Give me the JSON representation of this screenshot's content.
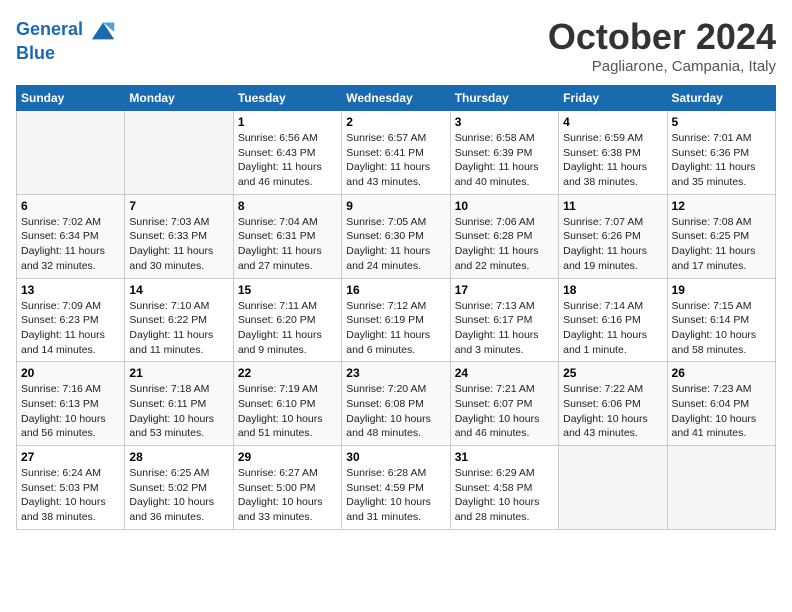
{
  "header": {
    "logo_line1": "General",
    "logo_line2": "Blue",
    "month": "October 2024",
    "location": "Pagliarone, Campania, Italy"
  },
  "weekdays": [
    "Sunday",
    "Monday",
    "Tuesday",
    "Wednesday",
    "Thursday",
    "Friday",
    "Saturday"
  ],
  "weeks": [
    [
      {
        "day": "",
        "empty": true
      },
      {
        "day": "",
        "empty": true
      },
      {
        "day": "1",
        "sunrise": "Sunrise: 6:56 AM",
        "sunset": "Sunset: 6:43 PM",
        "daylight": "Daylight: 11 hours and 46 minutes."
      },
      {
        "day": "2",
        "sunrise": "Sunrise: 6:57 AM",
        "sunset": "Sunset: 6:41 PM",
        "daylight": "Daylight: 11 hours and 43 minutes."
      },
      {
        "day": "3",
        "sunrise": "Sunrise: 6:58 AM",
        "sunset": "Sunset: 6:39 PM",
        "daylight": "Daylight: 11 hours and 40 minutes."
      },
      {
        "day": "4",
        "sunrise": "Sunrise: 6:59 AM",
        "sunset": "Sunset: 6:38 PM",
        "daylight": "Daylight: 11 hours and 38 minutes."
      },
      {
        "day": "5",
        "sunrise": "Sunrise: 7:01 AM",
        "sunset": "Sunset: 6:36 PM",
        "daylight": "Daylight: 11 hours and 35 minutes."
      }
    ],
    [
      {
        "day": "6",
        "sunrise": "Sunrise: 7:02 AM",
        "sunset": "Sunset: 6:34 PM",
        "daylight": "Daylight: 11 hours and 32 minutes."
      },
      {
        "day": "7",
        "sunrise": "Sunrise: 7:03 AM",
        "sunset": "Sunset: 6:33 PM",
        "daylight": "Daylight: 11 hours and 30 minutes."
      },
      {
        "day": "8",
        "sunrise": "Sunrise: 7:04 AM",
        "sunset": "Sunset: 6:31 PM",
        "daylight": "Daylight: 11 hours and 27 minutes."
      },
      {
        "day": "9",
        "sunrise": "Sunrise: 7:05 AM",
        "sunset": "Sunset: 6:30 PM",
        "daylight": "Daylight: 11 hours and 24 minutes."
      },
      {
        "day": "10",
        "sunrise": "Sunrise: 7:06 AM",
        "sunset": "Sunset: 6:28 PM",
        "daylight": "Daylight: 11 hours and 22 minutes."
      },
      {
        "day": "11",
        "sunrise": "Sunrise: 7:07 AM",
        "sunset": "Sunset: 6:26 PM",
        "daylight": "Daylight: 11 hours and 19 minutes."
      },
      {
        "day": "12",
        "sunrise": "Sunrise: 7:08 AM",
        "sunset": "Sunset: 6:25 PM",
        "daylight": "Daylight: 11 hours and 17 minutes."
      }
    ],
    [
      {
        "day": "13",
        "sunrise": "Sunrise: 7:09 AM",
        "sunset": "Sunset: 6:23 PM",
        "daylight": "Daylight: 11 hours and 14 minutes."
      },
      {
        "day": "14",
        "sunrise": "Sunrise: 7:10 AM",
        "sunset": "Sunset: 6:22 PM",
        "daylight": "Daylight: 11 hours and 11 minutes."
      },
      {
        "day": "15",
        "sunrise": "Sunrise: 7:11 AM",
        "sunset": "Sunset: 6:20 PM",
        "daylight": "Daylight: 11 hours and 9 minutes."
      },
      {
        "day": "16",
        "sunrise": "Sunrise: 7:12 AM",
        "sunset": "Sunset: 6:19 PM",
        "daylight": "Daylight: 11 hours and 6 minutes."
      },
      {
        "day": "17",
        "sunrise": "Sunrise: 7:13 AM",
        "sunset": "Sunset: 6:17 PM",
        "daylight": "Daylight: 11 hours and 3 minutes."
      },
      {
        "day": "18",
        "sunrise": "Sunrise: 7:14 AM",
        "sunset": "Sunset: 6:16 PM",
        "daylight": "Daylight: 11 hours and 1 minute."
      },
      {
        "day": "19",
        "sunrise": "Sunrise: 7:15 AM",
        "sunset": "Sunset: 6:14 PM",
        "daylight": "Daylight: 10 hours and 58 minutes."
      }
    ],
    [
      {
        "day": "20",
        "sunrise": "Sunrise: 7:16 AM",
        "sunset": "Sunset: 6:13 PM",
        "daylight": "Daylight: 10 hours and 56 minutes."
      },
      {
        "day": "21",
        "sunrise": "Sunrise: 7:18 AM",
        "sunset": "Sunset: 6:11 PM",
        "daylight": "Daylight: 10 hours and 53 minutes."
      },
      {
        "day": "22",
        "sunrise": "Sunrise: 7:19 AM",
        "sunset": "Sunset: 6:10 PM",
        "daylight": "Daylight: 10 hours and 51 minutes."
      },
      {
        "day": "23",
        "sunrise": "Sunrise: 7:20 AM",
        "sunset": "Sunset: 6:08 PM",
        "daylight": "Daylight: 10 hours and 48 minutes."
      },
      {
        "day": "24",
        "sunrise": "Sunrise: 7:21 AM",
        "sunset": "Sunset: 6:07 PM",
        "daylight": "Daylight: 10 hours and 46 minutes."
      },
      {
        "day": "25",
        "sunrise": "Sunrise: 7:22 AM",
        "sunset": "Sunset: 6:06 PM",
        "daylight": "Daylight: 10 hours and 43 minutes."
      },
      {
        "day": "26",
        "sunrise": "Sunrise: 7:23 AM",
        "sunset": "Sunset: 6:04 PM",
        "daylight": "Daylight: 10 hours and 41 minutes."
      }
    ],
    [
      {
        "day": "27",
        "sunrise": "Sunrise: 6:24 AM",
        "sunset": "Sunset: 5:03 PM",
        "daylight": "Daylight: 10 hours and 38 minutes."
      },
      {
        "day": "28",
        "sunrise": "Sunrise: 6:25 AM",
        "sunset": "Sunset: 5:02 PM",
        "daylight": "Daylight: 10 hours and 36 minutes."
      },
      {
        "day": "29",
        "sunrise": "Sunrise: 6:27 AM",
        "sunset": "Sunset: 5:00 PM",
        "daylight": "Daylight: 10 hours and 33 minutes."
      },
      {
        "day": "30",
        "sunrise": "Sunrise: 6:28 AM",
        "sunset": "Sunset: 4:59 PM",
        "daylight": "Daylight: 10 hours and 31 minutes."
      },
      {
        "day": "31",
        "sunrise": "Sunrise: 6:29 AM",
        "sunset": "Sunset: 4:58 PM",
        "daylight": "Daylight: 10 hours and 28 minutes."
      },
      {
        "day": "",
        "empty": true
      },
      {
        "day": "",
        "empty": true
      }
    ]
  ]
}
